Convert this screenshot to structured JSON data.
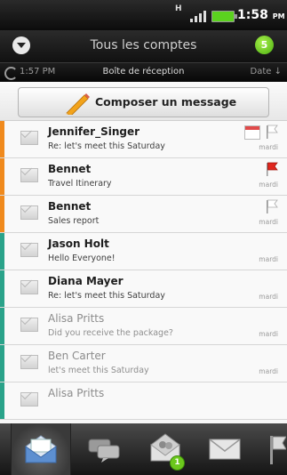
{
  "status_bar": {
    "network_type": "H",
    "time": "1:58",
    "ampm": "PM",
    "battery_color": "#5bd21f"
  },
  "header": {
    "account_title": "Tous les comptes",
    "unread_count": "5"
  },
  "folder_bar": {
    "last_sync": "1:57 PM",
    "folder_name": "Boîte de réception",
    "sort_label": "Date ↓"
  },
  "compose": {
    "label": "Composer un message",
    "icon": "pencil-icon"
  },
  "messages": [
    {
      "sender": "Jennifer_Singer",
      "subject": "Re: let's meet this Saturday",
      "date": "mardi",
      "unread": true,
      "color_bar": "#f08a1d",
      "flag": "white",
      "calendar": true
    },
    {
      "sender": "Bennet",
      "subject": "Travel Itinerary",
      "date": "mardi",
      "unread": true,
      "color_bar": "#f08a1d",
      "flag": "red",
      "calendar": false
    },
    {
      "sender": "Bennet",
      "subject": "Sales report",
      "date": "mardi",
      "unread": true,
      "color_bar": "#f08a1d",
      "flag": "white",
      "calendar": false
    },
    {
      "sender": "Jason Holt",
      "subject": "Hello Everyone!",
      "date": "mardi",
      "unread": true,
      "color_bar": "#2aa38a",
      "flag": "none",
      "calendar": false
    },
    {
      "sender": "Diana Mayer",
      "subject": "Re: let's meet this Saturday",
      "date": "mardi",
      "unread": true,
      "color_bar": "#2aa38a",
      "flag": "none",
      "calendar": false
    },
    {
      "sender": "Alisa Pritts",
      "subject": "Did you receive the package?",
      "date": "mardi",
      "unread": false,
      "color_bar": "#2aa38a",
      "flag": "none",
      "calendar": false
    },
    {
      "sender": "Ben Carter",
      "subject": "let's meet this Saturday",
      "date": "mardi",
      "unread": false,
      "color_bar": "#2aa38a",
      "flag": "none",
      "calendar": false
    },
    {
      "sender": "Alisa Pritts",
      "subject": "",
      "date": "",
      "unread": false,
      "color_bar": "#2aa38a",
      "flag": "none",
      "calendar": false
    }
  ],
  "tabs": [
    {
      "name": "inbox",
      "icon": "open-envelope-icon",
      "active": true
    },
    {
      "name": "conversations",
      "icon": "chat-bubbles-icon",
      "active": false
    },
    {
      "name": "group-mail",
      "icon": "people-envelope-icon",
      "active": false,
      "badge": "1"
    },
    {
      "name": "unread",
      "icon": "envelope-icon",
      "active": false
    },
    {
      "name": "flagged",
      "icon": "flag-icon",
      "active": false
    }
  ]
}
